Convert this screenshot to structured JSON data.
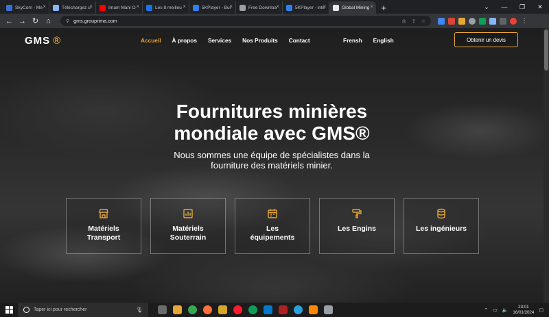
{
  "browser": {
    "tabs": [
      {
        "label": "SkyCom - Me",
        "favicon": "#3b6fd8",
        "active": false
      },
      {
        "label": "Téléchargez u",
        "favicon": "#8ab4f8",
        "active": false
      },
      {
        "label": "Imam Mahi O",
        "favicon": "#ff0000",
        "active": false
      },
      {
        "label": "Les 8 meilleu",
        "favicon": "#1a73e8",
        "active": false
      },
      {
        "label": "5KPlayer - Bui",
        "favicon": "#2f80ed",
        "active": false
      },
      {
        "label": "Free Downloa",
        "favicon": "#9aa0a6",
        "active": false
      },
      {
        "label": "5KPlayer - inte",
        "favicon": "#2f80ed",
        "active": false
      },
      {
        "label": "Global Mining",
        "favicon": "#e8eaed",
        "active": true
      }
    ],
    "new_tab": "+",
    "url": "gms.grouprima.com",
    "extensions": [
      "#4285f4",
      "#db4437",
      "#e8a735",
      "#9aa0a6",
      "#0f9d58",
      "#ea4335",
      "#8ab4f8"
    ]
  },
  "site": {
    "logo": "GMS",
    "logo_mark": "®",
    "nav": [
      "Accueil",
      "À propos",
      "Services",
      "Nos Produits",
      "Contact"
    ],
    "languages": [
      "Frensh",
      "English"
    ],
    "cta": "Obtenir un devis",
    "accent": "#e8a735"
  },
  "hero": {
    "title_line1": "Fournitures minières",
    "title_line2": "mondiale avec GMS®",
    "subtitle_line1": "Nous sommes une équipe de spécialistes dans la",
    "subtitle_line2": "fourniture des matériels minier."
  },
  "cards": [
    {
      "label_line1": "Matériels",
      "label_line2": "Transport",
      "icon": "store-icon"
    },
    {
      "label_line1": "Matériels",
      "label_line2": "Souterrain",
      "icon": "chart-icon"
    },
    {
      "label_line1": "Les",
      "label_line2": "équipements",
      "icon": "calendar-icon"
    },
    {
      "label_line1": "Les Engins",
      "label_line2": "",
      "icon": "paint-roller-icon"
    },
    {
      "label_line1": "Les ingénieurs",
      "label_line2": "",
      "icon": "database-icon"
    }
  ],
  "taskbar": {
    "search_placeholder": "Taper ici pour rechercher",
    "apps": [
      "#6b6b6b",
      "#e8a735",
      "#34a853",
      "#ff7139",
      "#d4a72c",
      "#ff1b2d",
      "#0f9d58",
      "#007acc",
      "#b01f24",
      "#2aa1d8",
      "#ff8800",
      "#9aa0a6"
    ],
    "time": "23:01",
    "date": "16/01/2024"
  }
}
